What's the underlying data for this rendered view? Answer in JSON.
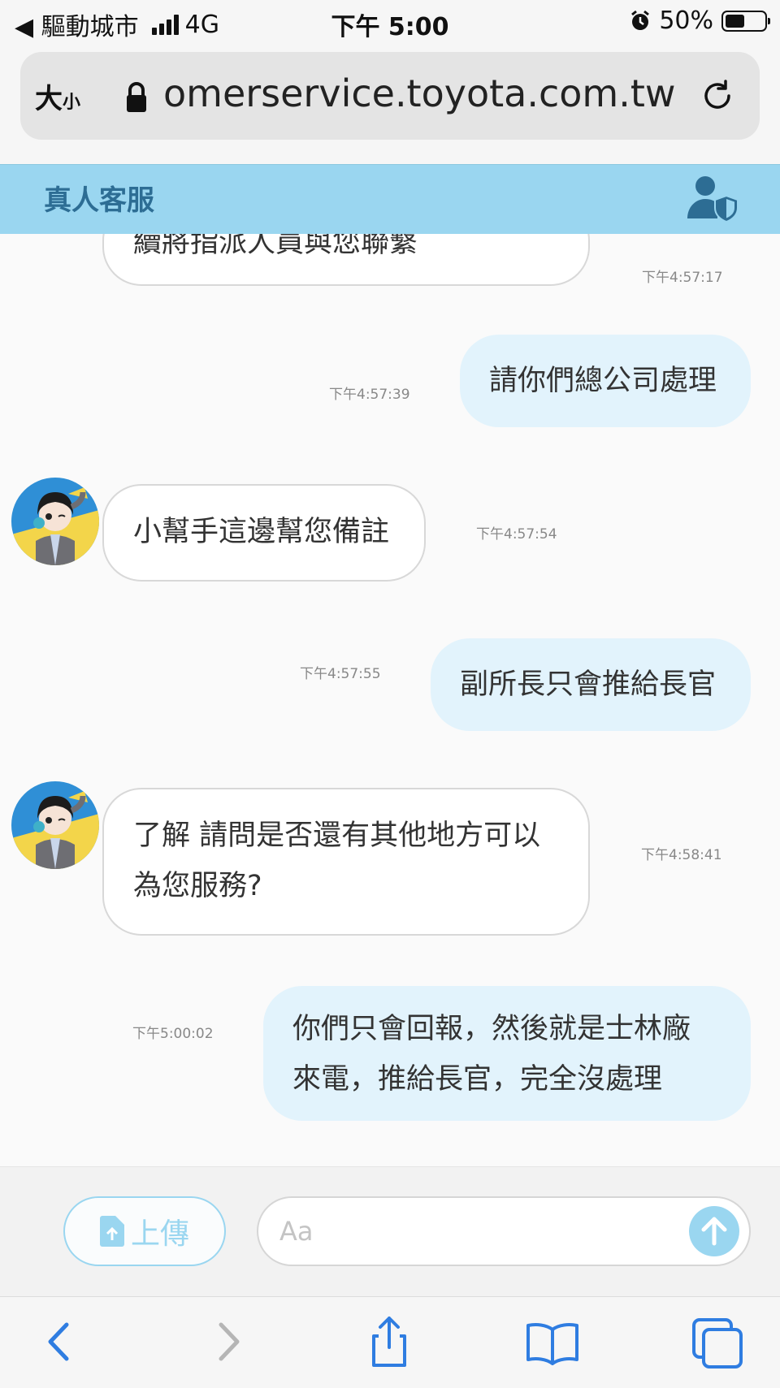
{
  "status_bar": {
    "back_app": "◀ 驅動城市",
    "network": "4G",
    "time": "下午 5:00",
    "battery_percent": "50%",
    "battery_level": 0.5
  },
  "browser": {
    "text_size_big": "大",
    "text_size_small": "小",
    "url": "omerservice.toyota.com.tw"
  },
  "chat_header": {
    "title": "真人客服",
    "agent_icon": "user-shield-icon"
  },
  "messages": [
    {
      "sender": "bot",
      "text": "續將指派人員與您聯繫",
      "time": "下午4:57:17"
    },
    {
      "sender": "user",
      "text": "請你們總公司處理",
      "time": "下午4:57:39"
    },
    {
      "sender": "bot",
      "text": "小幫手這邊幫您備註",
      "time": "下午4:57:54"
    },
    {
      "sender": "user",
      "text": "副所長只會推給長官",
      "time": "下午4:57:55"
    },
    {
      "sender": "bot",
      "text": "了解 請問是否還有其他地方可以\n為您服務?",
      "time": "下午4:58:41"
    },
    {
      "sender": "user",
      "text": "你們只會回報，然後就是士林廠\n來電，推給長官，完全沒處理",
      "time": "下午5:00:02"
    }
  ],
  "composer": {
    "upload_label": "上傳",
    "placeholder": "Aa"
  },
  "colors": {
    "header_bg": "#9ad6f0",
    "user_bubble": "#e2f3fc",
    "accent": "#9ad6f0",
    "toolbar_icon": "#2f7de1"
  }
}
